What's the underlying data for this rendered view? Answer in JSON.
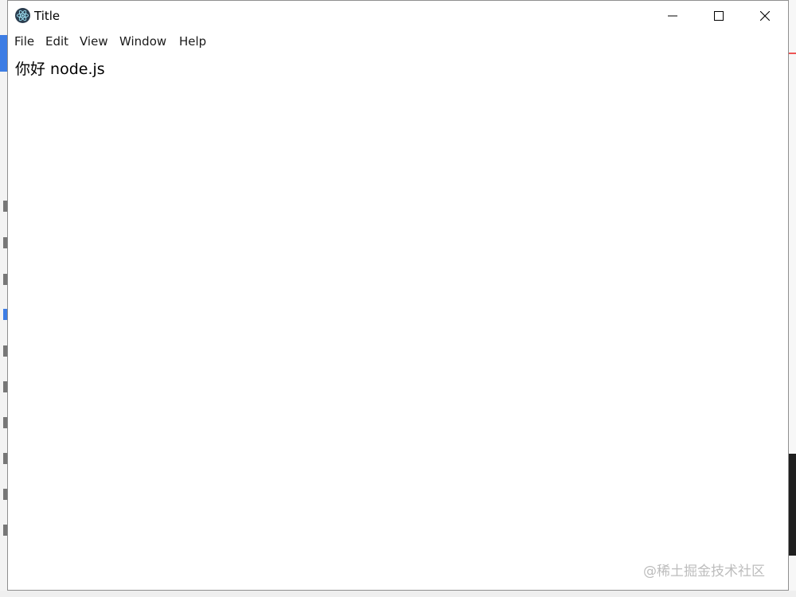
{
  "window": {
    "title": "Title",
    "icon": "electron-atom-icon",
    "controls": {
      "minimize": "minimize-icon",
      "maximize": "maximize-icon",
      "close": "close-icon"
    }
  },
  "menu": {
    "items": [
      {
        "label": "File"
      },
      {
        "label": "Edit"
      },
      {
        "label": "View"
      },
      {
        "label": "Window"
      },
      {
        "label": "Help"
      }
    ]
  },
  "content": {
    "text": "你好 node.js"
  },
  "watermark": {
    "text": "@稀土掘金技术社区"
  },
  "colors": {
    "window_bg": "#ffffff",
    "icon_bg": "#2b3e50",
    "text": "#000000"
  }
}
